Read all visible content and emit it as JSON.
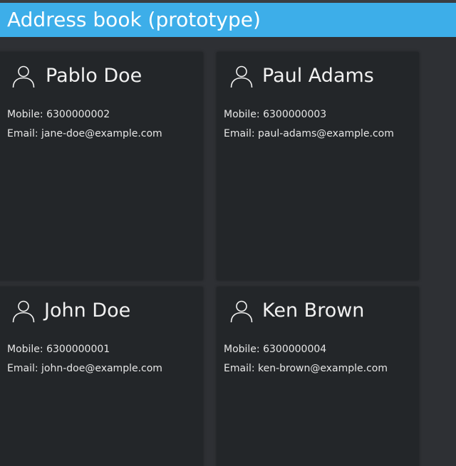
{
  "window": {
    "title": "Address book (prototype)"
  },
  "contacts": [
    {
      "name": "Pablo Doe",
      "mobile": "Mobile: 6300000002",
      "email": "Email: jane-doe@example.com"
    },
    {
      "name": "Paul Adams",
      "mobile": "Mobile: 6300000003",
      "email": "Email: paul-adams@example.com"
    },
    {
      "name": "John Doe",
      "mobile": "Mobile: 6300000001",
      "email": "Email: john-doe@example.com"
    },
    {
      "name": "Ken Brown",
      "mobile": "Mobile: 6300000004",
      "email": "Email: ken-brown@example.com"
    }
  ],
  "colors": {
    "title_bar": "#3daee9",
    "background": "#2e3034",
    "card": "#232629",
    "text": "#f1f1f1"
  },
  "icons": {
    "contact": "person-icon"
  }
}
